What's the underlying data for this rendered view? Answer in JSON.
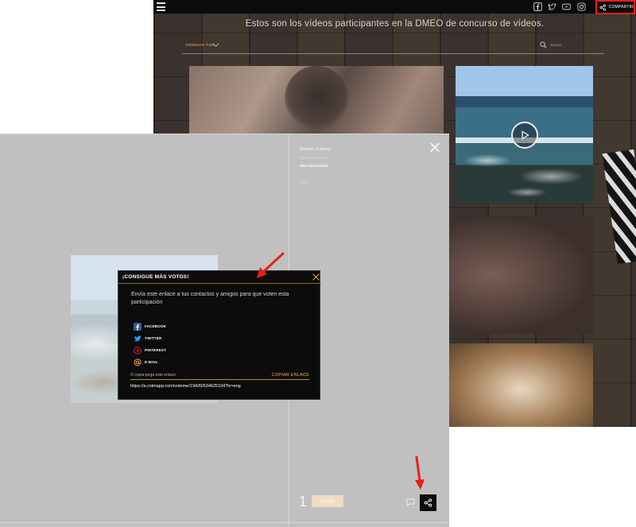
{
  "site": {
    "headline": "Estos son los vídeos participantes en la DMEO de concurso de vídeos.",
    "sort_label": "ORDENAR POR",
    "search_placeholder": "Buscar...",
    "share_label": "COMPARTIR",
    "social_icons": [
      "facebook-icon",
      "twitter-icon",
      "youtube-icon",
      "instagram-icon"
    ]
  },
  "entry": {
    "author": "Marian Jubany",
    "date": "23-06-2016 00:00",
    "more_info": "Más información",
    "tag": "Vídeo",
    "vote_count": "1",
    "vote_button": "VOTAR"
  },
  "popup": {
    "title": "¡CONSIGUE MÁS VOTOS!",
    "description": "Envía este enlace a tus contactos y amigos para que voten esta participación",
    "networks": [
      {
        "label": "FACEBOOK",
        "icon": "facebook-icon",
        "color": "#3b5998"
      },
      {
        "label": "TWITTER",
        "icon": "twitter-icon",
        "color": "#1da1f2"
      },
      {
        "label": "PINTEREST",
        "icon": "pinterest-icon",
        "color": "#cb2027"
      },
      {
        "label": "E-MAIL",
        "icon": "at-icon",
        "color": "#f2a736"
      }
    ],
    "copy_hint": "O copia-pega este enlace",
    "copy_button": "COPIAR ENLACE",
    "url": "https://a.cstmapp.com/voteme/19420/634625104?lc=eng"
  },
  "colors": {
    "accent": "#f2b34a",
    "annotation": "#e3221a",
    "overlay": "#c0c0c0",
    "popup_bg": "#0c0c0c"
  }
}
